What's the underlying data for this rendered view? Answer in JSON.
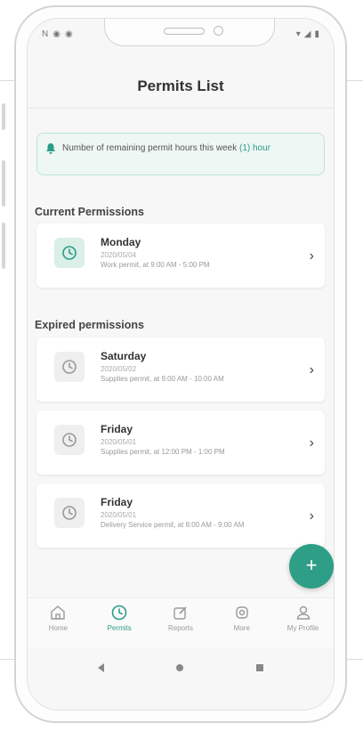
{
  "status": {
    "left_icons": [
      "N",
      "circle-icon",
      "circle-icon"
    ],
    "right_icons": [
      "wifi-icon",
      "signal-icon",
      "battery-icon"
    ]
  },
  "header": {
    "title": "Permits List"
  },
  "banner": {
    "text": "Number of remaining permit hours this week",
    "highlight": "(1) hour",
    "accent": "#2a9d85"
  },
  "current": {
    "title": "Current Permissions",
    "items": [
      {
        "day": "Monday",
        "date": "2020/05/04",
        "desc": "Work permit, at 9:00 AM - 5:00 PM"
      }
    ]
  },
  "expired": {
    "title": "Expired permissions",
    "items": [
      {
        "day": "Saturday",
        "date": "2020/05/02",
        "desc": "Supplies permit, at 9:00 AM - 10:00 AM"
      },
      {
        "day": "Friday",
        "date": "2020/05/01",
        "desc": "Supplies permit, at 12:00 PM - 1:00 PM"
      },
      {
        "day": "Friday",
        "date": "2020/05/01",
        "desc": "Delivery Service permit, at 8:00 AM - 9:00 AM"
      }
    ]
  },
  "fab": {
    "label": "+"
  },
  "nav": {
    "items": [
      {
        "label": "Home",
        "icon": "home-icon"
      },
      {
        "label": "Permits",
        "icon": "clock-icon"
      },
      {
        "label": "Reports",
        "icon": "edit-icon"
      },
      {
        "label": "More",
        "icon": "more-icon"
      },
      {
        "label": "My Profile",
        "icon": "user-icon"
      }
    ],
    "active": "Permits"
  },
  "colors": {
    "accent": "#2e9e87",
    "banner_border": "#bfe3d8",
    "banner_bg": "#eef7f3"
  }
}
